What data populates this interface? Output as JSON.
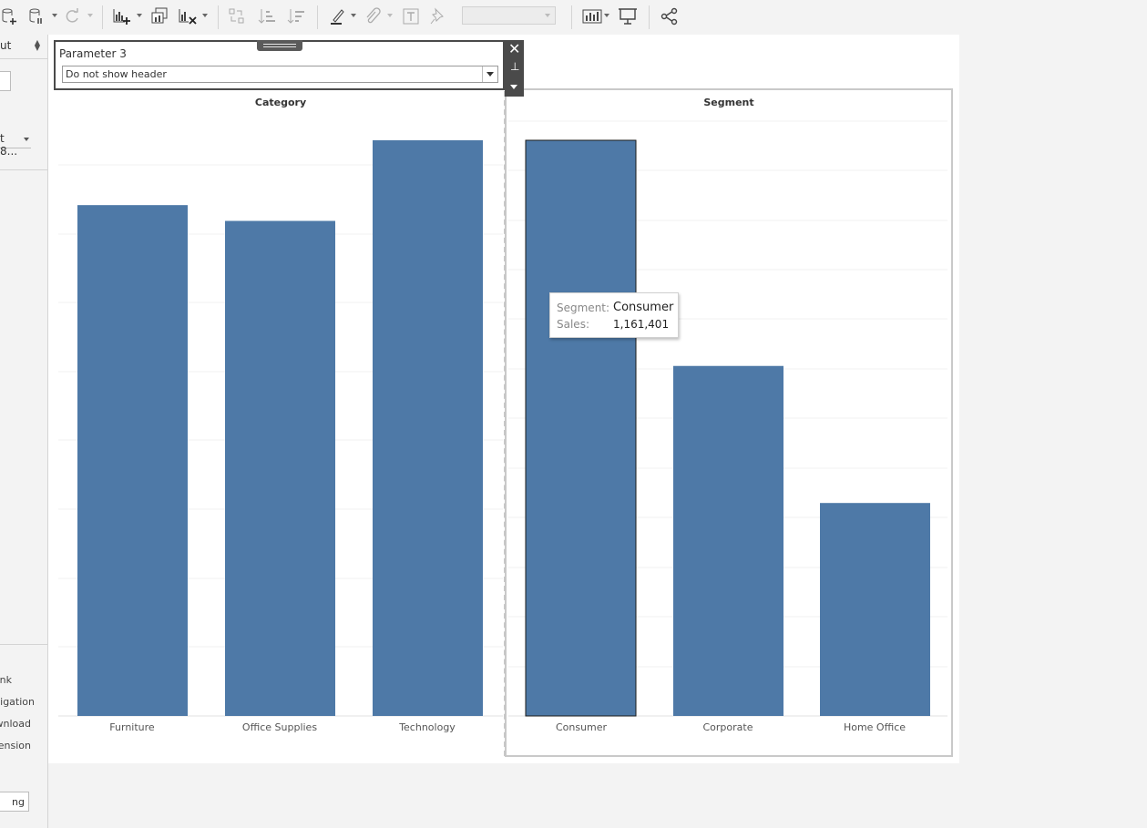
{
  "toolbar": {
    "icons": [
      "new-data-source-icon",
      "pause-data-icon",
      "refresh-icon",
      "new-worksheet-icon",
      "duplicate-sheet-icon",
      "clear-sheet-icon",
      "swap-rows-columns-icon",
      "sort-ascending-icon",
      "sort-descending-icon",
      "highlight-icon",
      "group-members-icon",
      "show-mark-labels-icon",
      "fix-axes-icon",
      "show-me-icon",
      "presentation-mode-icon",
      "share-icon"
    ],
    "fit_value": ""
  },
  "left_panel": {
    "layout_select": "ut",
    "size_select": "t 8...",
    "items": [
      "nk",
      "vigation",
      "wnload",
      "ension"
    ],
    "button": "ng"
  },
  "parameter": {
    "title": "Parameter 3",
    "value": "Do not show header"
  },
  "colors": {
    "bar": "#4e79a7",
    "selected_border": "#1a1a1a"
  },
  "tooltip": {
    "segment_key": "Segment:",
    "segment_value": "Consumer",
    "sales_key": "Sales:",
    "sales_value": "1,161,401"
  },
  "chart_data": [
    {
      "type": "bar",
      "title": "Category",
      "categories": [
        "Furniture",
        "Office Supplies",
        "Technology"
      ],
      "values": [
        742000,
        719047,
        836154
      ],
      "ylim": [
        0,
        836154
      ],
      "grid": true
    },
    {
      "type": "bar",
      "title": "Segment",
      "categories": [
        "Consumer",
        "Corporate",
        "Home Office"
      ],
      "values": [
        1161401,
        706146,
        429653
      ],
      "selected": "Consumer",
      "ylim": [
        0,
        1161401
      ],
      "grid": true
    }
  ]
}
